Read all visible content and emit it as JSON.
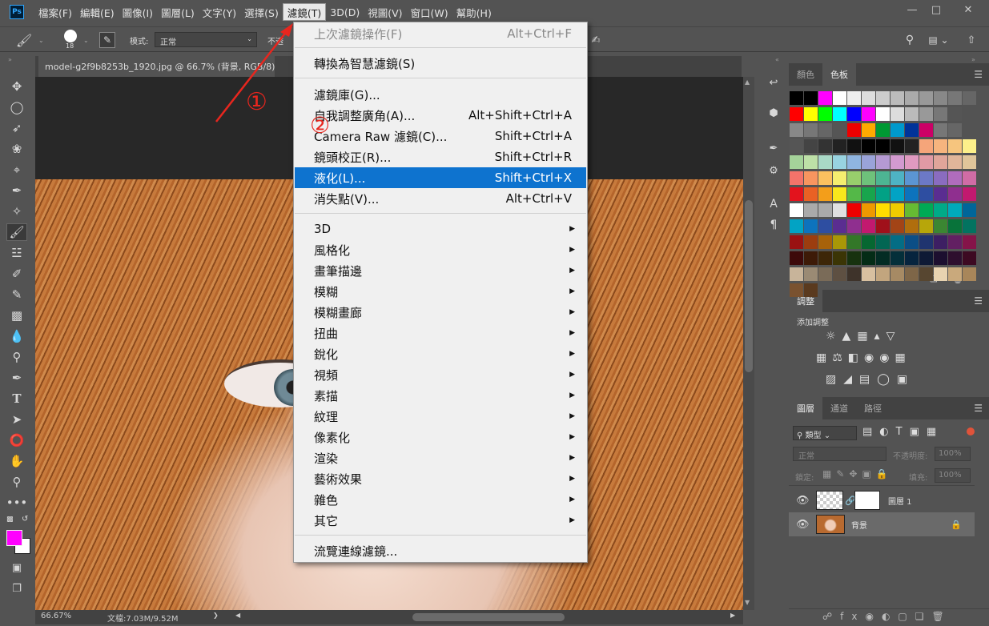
{
  "app": {
    "logo": "Ps"
  },
  "menubar": {
    "items": [
      "檔案(F)",
      "編輯(E)",
      "圖像(I)",
      "圖層(L)",
      "文字(Y)",
      "選擇(S)",
      "濾鏡(T)",
      "3D(D)",
      "視圖(V)",
      "窗口(W)",
      "幫助(H)"
    ],
    "active_index": 6
  },
  "options": {
    "brush_size": "18",
    "mode_label": "模式:",
    "mode_value": "正常",
    "opacity_label": "不透"
  },
  "document": {
    "tab_title": "model-g2f9b8253b_1920.jpg @ 66.7% (背景, RGB/8) *",
    "zoom": "66.67%",
    "file_info": "文檔:7.03M/9.52M"
  },
  "filter_menu": {
    "last_filter": {
      "label": "上次濾鏡操作(F)",
      "shortcut": "Alt+Ctrl+F"
    },
    "smart": {
      "label": "轉換為智慧濾鏡(S)"
    },
    "gallery": {
      "label": "濾鏡庫(G)..."
    },
    "adaptive": {
      "label": "自我調整廣角(A)...",
      "shortcut": "Alt+Shift+Ctrl+A"
    },
    "camera_raw": {
      "label": "Camera Raw 濾鏡(C)...",
      "shortcut": "Shift+Ctrl+A"
    },
    "lens": {
      "label": "鏡頭校正(R)...",
      "shortcut": "Shift+Ctrl+R"
    },
    "liquify": {
      "label": "液化(L)...",
      "shortcut": "Shift+Ctrl+X"
    },
    "vanishing": {
      "label": "消失點(V)...",
      "shortcut": "Alt+Ctrl+V"
    },
    "submenus": [
      "3D",
      "風格化",
      "畫筆描邊",
      "模糊",
      "模糊畫廊",
      "扭曲",
      "銳化",
      "視頻",
      "素描",
      "紋理",
      "像素化",
      "渲染",
      "藝術效果",
      "雜色",
      "其它"
    ],
    "browse": {
      "label": "流覽連線濾鏡..."
    }
  },
  "annotations": {
    "step1": "①",
    "step2": "②",
    "arrow_color": "#e8261e"
  },
  "swatch_panel": {
    "tabs": [
      "顏色",
      "色板"
    ],
    "active": 1
  },
  "adjust_panel": {
    "title": "調整",
    "subtitle": "添加調整"
  },
  "layers_panel": {
    "tabs": [
      "圖層",
      "通道",
      "路徑"
    ],
    "filter_kind": "類型",
    "blend": "正常",
    "opacity_label": "不透明度:",
    "opacity_value": "100%",
    "lock_label": "鎖定:",
    "fill_label": "填充:",
    "fill_value": "100%",
    "layers": [
      {
        "name": "圖層 1"
      },
      {
        "name": "背景"
      }
    ]
  },
  "colors": {
    "foreground": "#ff00ff",
    "background": "#ffffff",
    "highlight": "#0e73cf"
  }
}
